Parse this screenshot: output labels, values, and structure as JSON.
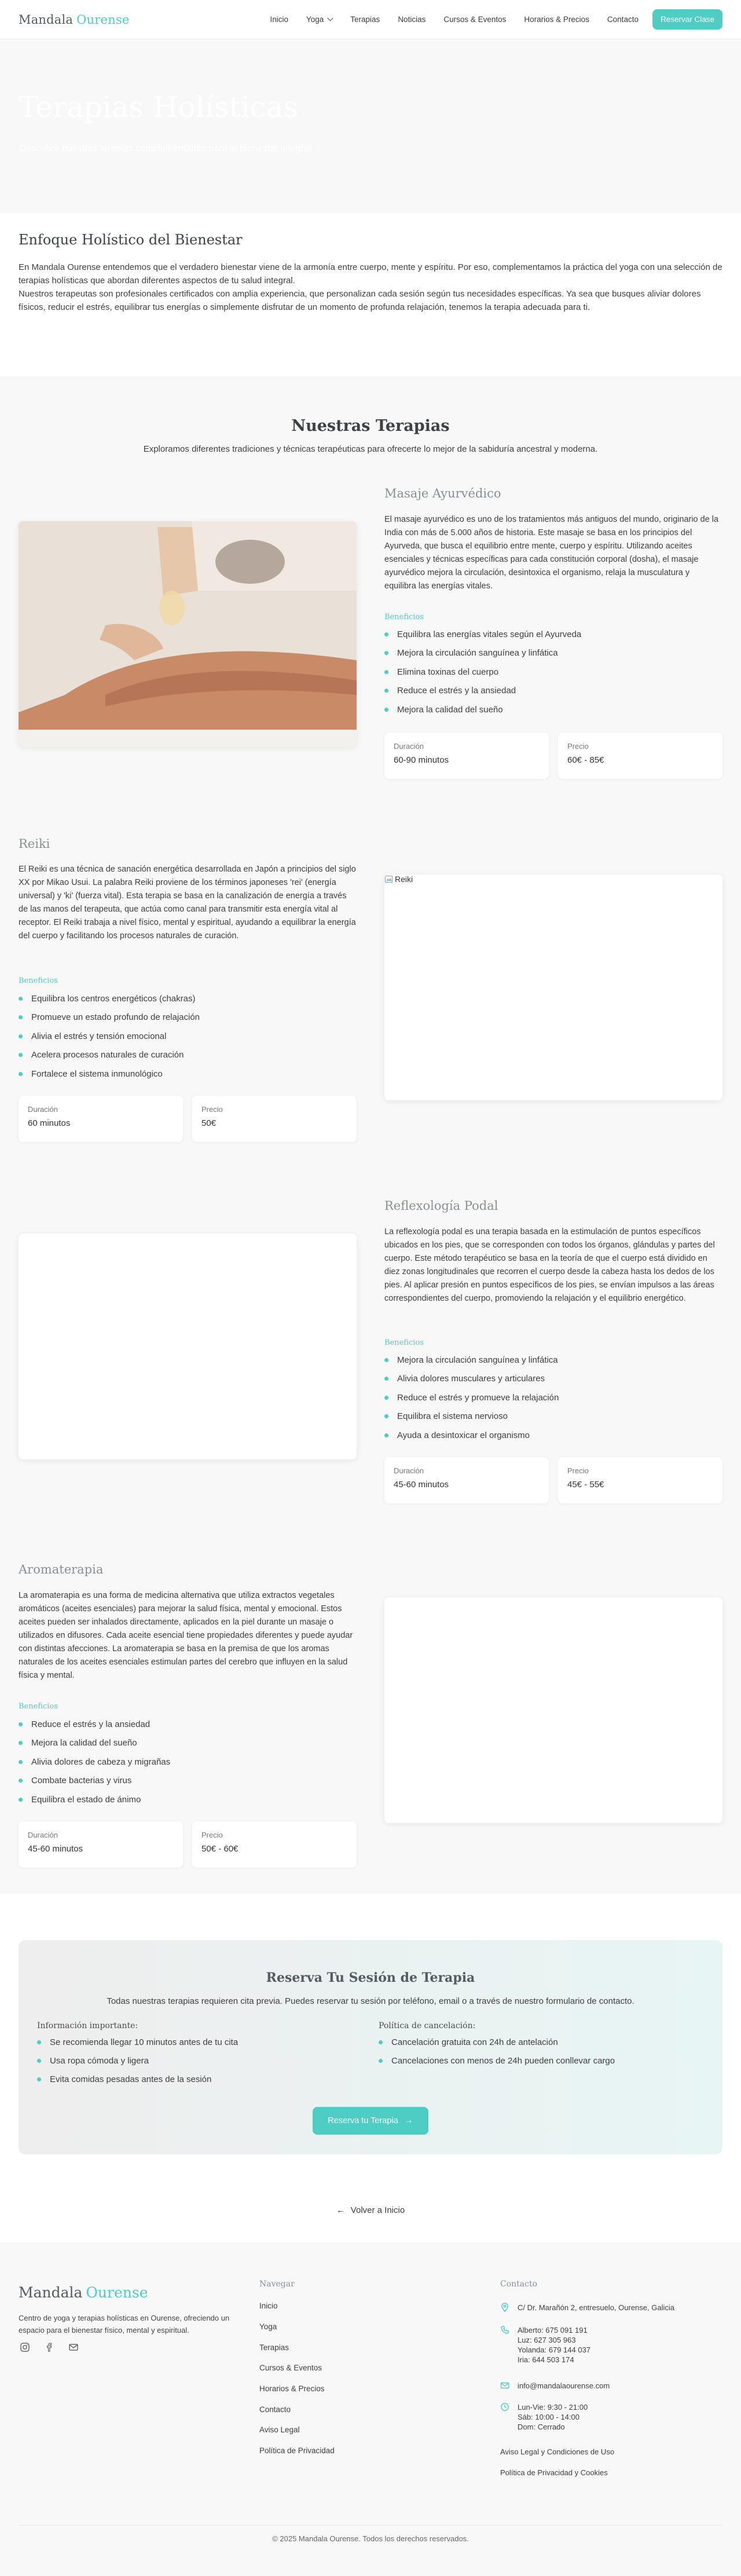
{
  "header": {
    "logo_main": "Mandala",
    "logo_accent": "Ourense",
    "nav": [
      "Inicio",
      "Yoga",
      "Terapias",
      "Noticias",
      "Cursos & Eventos",
      "Horarios & Precios",
      "Contacto"
    ],
    "cta": "Reservar Clase"
  },
  "hero": {
    "title": "Terapias Holísticas",
    "subtitle": "Descubre nuestras terapias complementarias para tu bienestar integral"
  },
  "intro": {
    "title": "Enfoque Holístico del Bienestar",
    "p1": "En Mandala Ourense entendemos que el verdadero bienestar viene de la armonía entre cuerpo, mente y espíritu. Por eso, complementamos la práctica del yoga con una selección de terapias holísticas que abordan diferentes aspectos de tu salud integral.",
    "p2": "Nuestros terapeutas son profesionales certificados con amplia experiencia, que personalizan cada sesión según tus necesidades específicas. Ya sea que busques aliviar dolores físicos, reducir el estrés, equilibrar tus energías o simplemente disfrutar de un momento de profunda relajación, tenemos la terapia adecuada para ti."
  },
  "therapies_section": {
    "title": "Nuestras Terapias",
    "subtitle": "Exploramos diferentes tradiciones y técnicas terapéuticas para ofrecerte lo mejor de la sabiduría ancestral y moderna.",
    "benefits_label": "Beneficios",
    "duration_label": "Duración",
    "price_label": "Precio",
    "items": [
      {
        "title": "Masaje Ayurvédico",
        "image_alt": "",
        "description": "El masaje ayurvédico es uno de los tratamientos más antiguos del mundo, originario de la India con más de 5.000 años de historia. Este masaje se basa en los principios del Ayurveda, que busca el equilibrio entre mente, cuerpo y espíritu. Utilizando aceites esenciales y técnicas específicas para cada constitución corporal (dosha), el masaje ayurvédico mejora la circulación, desintoxica el organismo, relaja la musculatura y equilibra las energías vitales.",
        "benefits": [
          "Equilibra las energías vitales según el Ayurveda",
          "Mejora la circulación sanguínea y linfática",
          "Elimina toxinas del cuerpo",
          "Reduce el estrés y la ansiedad",
          "Mejora la calidad del sueño"
        ],
        "duration": "60-90 minutos",
        "price": "60€ - 85€"
      },
      {
        "title": "Reiki",
        "image_alt": "Reiki",
        "description": "El Reiki es una técnica de sanación energética desarrollada en Japón a principios del siglo XX por Mikao Usui. La palabra Reiki proviene de los términos japoneses 'rei' (energía universal) y 'ki' (fuerza vital). Esta terapia se basa en la canalización de energía a través de las manos del terapeuta, que actúa como canal para transmitir esta energía vital al receptor. El Reiki trabaja a nivel físico, mental y espiritual, ayudando a equilibrar la energía del cuerpo y facilitando los procesos naturales de curación.",
        "benefits": [
          "Equilibra los centros energéticos (chakras)",
          "Promueve un estado profundo de relajación",
          "Alivia el estrés y tensión emocional",
          "Acelera procesos naturales de curación",
          "Fortalece el sistema inmunológico"
        ],
        "duration": "60 minutos",
        "price": "50€"
      },
      {
        "title": "Reflexología Podal",
        "image_alt": "",
        "description": "La reflexología podal es una terapia basada en la estimulación de puntos específicos ubicados en los pies, que se corresponden con todos los órganos, glándulas y partes del cuerpo. Este método terapéutico se basa en la teoría de que el cuerpo está dividido en diez zonas longitudinales que recorren el cuerpo desde la cabeza hasta los dedos de los pies. Al aplicar presión en puntos específicos de los pies, se envían impulsos a las áreas correspondientes del cuerpo, promoviendo la relajación y el equilibrio energético.",
        "benefits": [
          "Mejora la circulación sanguínea y linfática",
          "Alivia dolores musculares y articulares",
          "Reduce el estrés y promueve la relajación",
          "Equilibra el sistema nervioso",
          "Ayuda a desintoxicar el organismo"
        ],
        "duration": "45-60 minutos",
        "price": "45€ - 55€"
      },
      {
        "title": "Aromaterapia",
        "image_alt": "",
        "description": "La aromaterapia es una forma de medicina alternativa que utiliza extractos vegetales aromáticos (aceites esenciales) para mejorar la salud física, mental y emocional. Estos aceites pueden ser inhalados directamente, aplicados en la piel durante un masaje o utilizados en difusores. Cada aceite esencial tiene propiedades diferentes y puede ayudar con distintas afecciones. La aromaterapia se basa en la premisa de que los aromas naturales de los aceites esenciales estimulan partes del cerebro que influyen en la salud física y mental.",
        "benefits": [
          "Reduce el estrés y la ansiedad",
          "Mejora la calidad del sueño",
          "Alivia dolores de cabeza y migrañas",
          "Combate bacterias y virus",
          "Equilibra el estado de ánimo"
        ],
        "duration": "45-60 minutos",
        "price": "50€ - 60€"
      }
    ]
  },
  "booking": {
    "title": "Reserva Tu Sesión de Terapia",
    "subtitle": "Todas nuestras terapias requieren cita previa. Puedes reservar tu sesión por teléfono, email o a través de nuestro formulario de contacto.",
    "info_title": "Información importante:",
    "info_items": [
      "Se recomienda llegar 10 minutos antes de tu cita",
      "Usa ropa cómoda y ligera",
      "Evita comidas pesadas antes de la sesión"
    ],
    "cancel_title": "Política de cancelación:",
    "cancel_items": [
      "Cancelación gratuita con 24h de antelación",
      "Cancelaciones con menos de 24h pueden conllevar cargo"
    ],
    "button": "Reserva tu Terapia"
  },
  "back_link": "Volver a Inicio",
  "footer": {
    "logo_main": "Mandala",
    "logo_accent": "Ourense",
    "description": "Centro de yoga y terapias holísticas en Ourense, ofreciendo un espacio para el bienestar físico, mental y espiritual.",
    "nav_title": "Navegar",
    "nav_links": [
      "Inicio",
      "Yoga",
      "Terapias",
      "Cursos & Eventos",
      "Horarios & Precios",
      "Contacto",
      "Aviso Legal",
      "Política de Privacidad"
    ],
    "contact_title": "Contacto",
    "address": "C/ Dr. Marañón 2, entresuelo, Ourense, Galicia",
    "phones": [
      "Alberto: 675 091 191",
      "Luz: 627 305 963",
      "Yolanda: 679 144 037",
      "Iria: 644 503 174"
    ],
    "email": "info@mandalaourense.com",
    "hours": [
      "Lun-Vie: 9:30 - 21:00",
      "Sáb: 10:00 - 14:00",
      "Dom: Cerrado"
    ],
    "legal_links": [
      "Aviso Legal y Condiciones de Uso",
      "Política de Privacidad y Cookies"
    ],
    "copyright": "© 2025 Mandala Ourense. Todos los derechos reservados."
  },
  "colors": {
    "accent": "#4ecdc4",
    "text": "#3d3d3d",
    "muted_title": "#8a8f92",
    "section_bg": "#f8f8f8"
  }
}
